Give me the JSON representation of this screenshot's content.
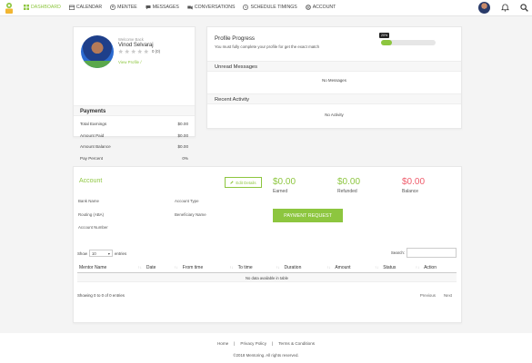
{
  "nav": {
    "items": [
      {
        "label": "DASHBOARD",
        "icon": "dashboard-icon"
      },
      {
        "label": "CALENDAR",
        "icon": "calendar-icon"
      },
      {
        "label": "MENTEE",
        "icon": "user-icon"
      },
      {
        "label": "MESSAGES",
        "icon": "chat-icon"
      },
      {
        "label": "CONVERSATIONS",
        "icon": "video-icon"
      },
      {
        "label": "SCHEDULE TIMINGS",
        "icon": "clock-icon"
      },
      {
        "label": "ACCOUNT",
        "icon": "gear-icon"
      }
    ],
    "active": "DASHBOARD"
  },
  "profile": {
    "welcome": "Welcome Back",
    "name": "Vinod Selvaraj",
    "rating_text": "0 (0)",
    "view_profile": "View Profile /"
  },
  "payments": {
    "title": "Payments",
    "rows": [
      {
        "label": "Total Earnings",
        "value": "$0.00"
      },
      {
        "label": "Amount Paid",
        "value": "$0.00"
      },
      {
        "label": "Amount Balance",
        "value": "$0.00"
      },
      {
        "label": "Pay Percent",
        "value": "0%"
      }
    ]
  },
  "progress": {
    "title": "Profile Progress",
    "subtitle": "You must fully complete your profile for get the exact match",
    "percent_label": "20%",
    "percent": 20
  },
  "unread": {
    "title": "Unread Messages",
    "message": "No Messages"
  },
  "activity": {
    "title": "Recent Activity",
    "message": "No Activity"
  },
  "account": {
    "title": "Account",
    "edit_label": "Edit Details",
    "earned": {
      "amount": "$0.00",
      "label": "Earned",
      "color": "#8dc63f"
    },
    "refunded": {
      "amount": "$0.00",
      "label": "Refunded",
      "color": "#8dc63f"
    },
    "balance": {
      "amount": "$0.00",
      "label": "Balance",
      "color": "#ef5b6b"
    },
    "fields": {
      "bank_name": "Bank Name",
      "routing": "Routing (ABA)",
      "account_number": "Account Number",
      "account_type": "Account Type",
      "beneficiary": "Beneficiary Name"
    },
    "payment_request": "PAYMENT REQUEST"
  },
  "table": {
    "show_label": "Show",
    "entries_value": "10",
    "entries_label": "entries",
    "search_label": "Search:",
    "columns": [
      "Mentor Name",
      "Date",
      "From time",
      "To time",
      "Duration",
      "Amount",
      "Status",
      "Action"
    ],
    "empty": "No data available in table",
    "info": "Showing 0 to 0 of 0 entries",
    "previous": "Previous",
    "next": "Next"
  },
  "footer": {
    "links": [
      "Home",
      "Privacy Policy",
      "Terms & Conditions"
    ],
    "separator": "|",
    "copyright": "©2018 Mentoring. All rights reserved."
  },
  "colors": {
    "accent": "#8dc63f",
    "danger": "#ef5b6b"
  }
}
